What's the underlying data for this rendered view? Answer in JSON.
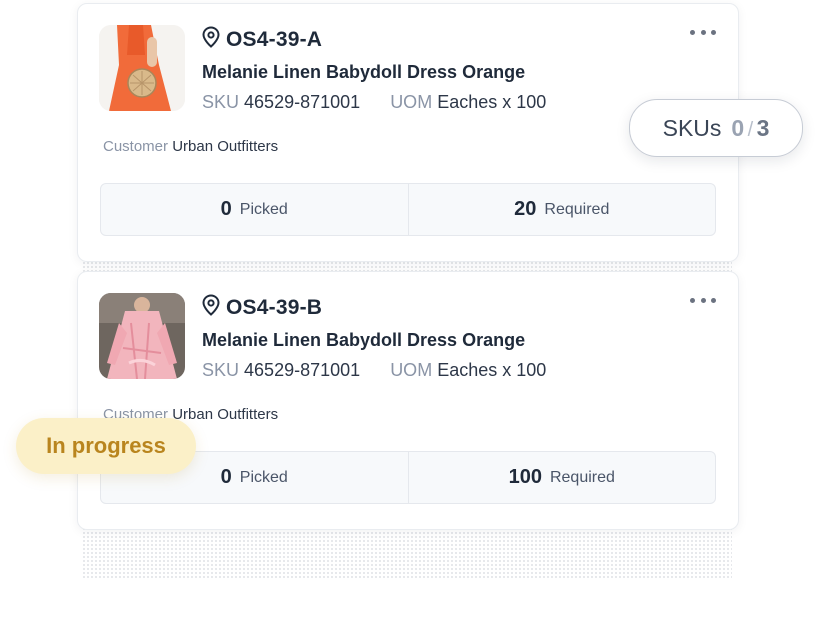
{
  "cards": [
    {
      "location": "OS4-39-A",
      "product_name": "Melanie Linen Babydoll Dress Orange",
      "sku_label": "SKU",
      "sku_value": "46529-871001",
      "uom_label": "UOM",
      "uom_value": "Eaches x 100",
      "customer_label": "Customer",
      "customer_value": "Urban Outfitters",
      "picked_count": "0",
      "picked_label": "Picked",
      "required_count": "20",
      "required_label": "Required"
    },
    {
      "location": "OS4-39-B",
      "product_name": "Melanie Linen Babydoll Dress Orange",
      "sku_label": "SKU",
      "sku_value": "46529-871001",
      "uom_label": "UOM",
      "uom_value": "Eaches x 100",
      "customer_label": "Customer",
      "customer_value": "Urban Outfitters",
      "picked_count": "0",
      "picked_label": "Picked",
      "required_count": "100",
      "required_label": "Required"
    }
  ],
  "sku_progress": {
    "label": "SKUs",
    "done": "0",
    "separator": "/",
    "total": "3"
  },
  "status_badge": {
    "label": "In progress",
    "color": "#b9851e",
    "background": "#fbf0c8"
  },
  "icons": {
    "location": "map-pin-icon",
    "more": "more-horizontal-icon"
  }
}
